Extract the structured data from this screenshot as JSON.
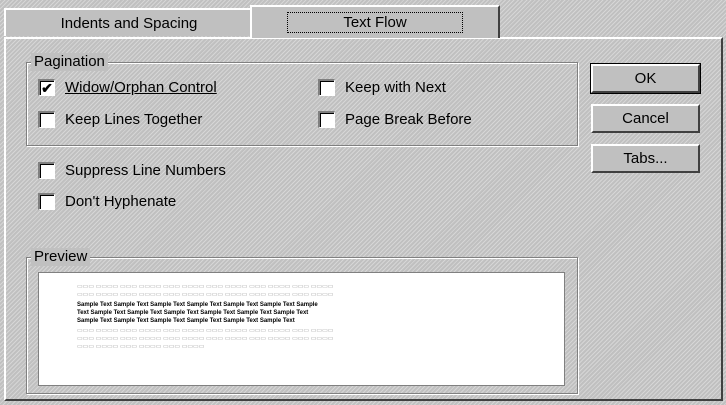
{
  "tabs": [
    {
      "label": "Indents and Spacing",
      "accel": "I",
      "active": false
    },
    {
      "label": "Text Flow",
      "accel": "F",
      "active": true
    }
  ],
  "pagination": {
    "legend": "Pagination",
    "options": [
      {
        "label": "Widow/Orphan Control",
        "checked": true
      },
      {
        "label": "Keep with Next",
        "checked": false
      },
      {
        "label": "Keep Lines Together",
        "checked": false
      },
      {
        "label": "Page Break Before",
        "checked": false
      }
    ]
  },
  "suppress_line_numbers": {
    "label": "Suppress Line Numbers",
    "checked": false
  },
  "dont_hyphenate": {
    "label": "Don't Hyphenate",
    "checked": false
  },
  "buttons": {
    "ok": "OK",
    "cancel": "Cancel",
    "tabs": "Tabs..."
  },
  "preview": {
    "legend": "Preview",
    "sample_lines": [
      "Sample Text Sample Text Sample Text Sample Text Sample Text Sample Text Sample",
      "Text Sample Text Sample Text Sample Text Sample Text Sample Text Sample Text",
      "Sample Text Sample Text Sample Text Sample Text Sample Text Sample Text"
    ]
  },
  "colors": {
    "face": "#c0c0c0",
    "shadow": "#808080",
    "highlight": "#ffffff",
    "dark_shadow": "#404040"
  }
}
